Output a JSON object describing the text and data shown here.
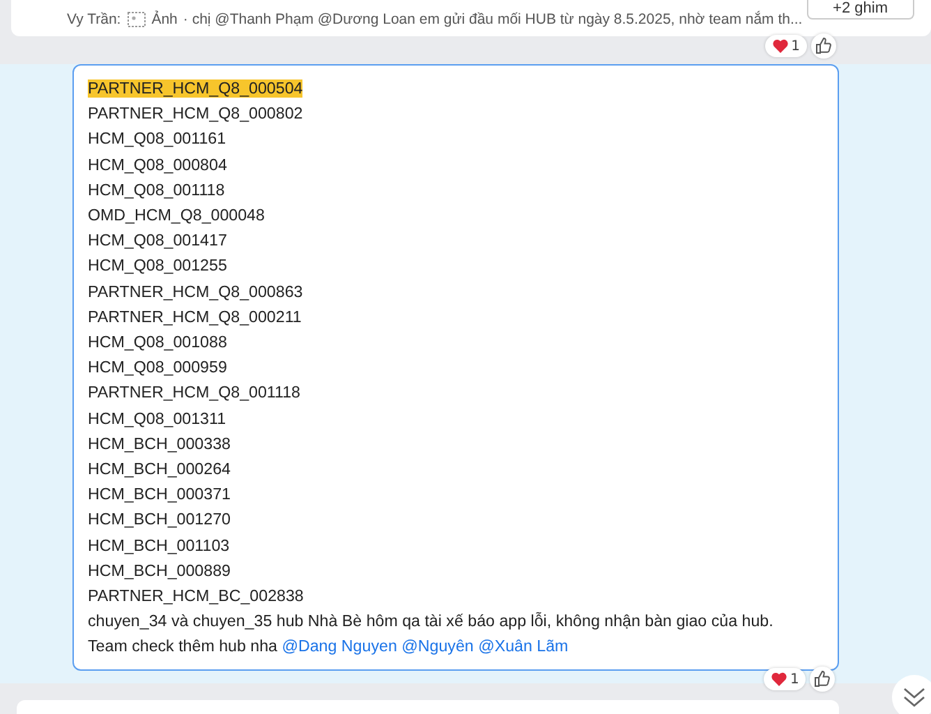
{
  "pinned_bar": {
    "sender": "Vy Trần:",
    "attachment": "Ảnh",
    "preview": "· chị @Thanh Phạm @Dương Loan em gửi đầu mối HUB từ ngày 8.5.2025, nhờ team nắm th...",
    "more_button": "+2 ghim"
  },
  "previous_message": {
    "reactions": {
      "count": "1"
    }
  },
  "message": {
    "selected": true,
    "lines": [
      {
        "text": "PARTNER_HCM_Q8_000504",
        "highlighted": true
      },
      {
        "text": "PARTNER_HCM_Q8_000802",
        "highlighted": false
      },
      {
        "text": "HCM_Q08_001161",
        "highlighted": false
      },
      {
        "text": "HCM_Q08_000804",
        "highlighted": false
      },
      {
        "text": "HCM_Q08_001118",
        "highlighted": false
      },
      {
        "text": "OMD_HCM_Q8_000048",
        "highlighted": false
      },
      {
        "text": "HCM_Q08_001417",
        "highlighted": false
      },
      {
        "text": "HCM_Q08_001255",
        "highlighted": false
      },
      {
        "text": "PARTNER_HCM_Q8_000863",
        "highlighted": false
      },
      {
        "text": "PARTNER_HCM_Q8_000211",
        "highlighted": false
      },
      {
        "text": "HCM_Q08_001088",
        "highlighted": false
      },
      {
        "text": "HCM_Q08_000959",
        "highlighted": false
      },
      {
        "text": "PARTNER_HCM_Q8_001118",
        "highlighted": false
      },
      {
        "text": "HCM_Q08_001311",
        "highlighted": false
      },
      {
        "text": "HCM_BCH_000338",
        "highlighted": false
      },
      {
        "text": "HCM_BCH_000264",
        "highlighted": false
      },
      {
        "text": "HCM_BCH_000371",
        "highlighted": false
      },
      {
        "text": "HCM_BCH_001270",
        "highlighted": false
      },
      {
        "text": "HCM_BCH_001103",
        "highlighted": false
      },
      {
        "text": "HCM_BCH_000889",
        "highlighted": false
      },
      {
        "text": "PARTNER_HCM_BC_002838",
        "highlighted": false
      },
      {
        "text": "chuyen_34 và chuyen_35 hub Nhà Bè hôm qa tài xế báo app lỗi, không nhận bàn giao của hub.",
        "highlighted": false
      }
    ],
    "last_line": {
      "text": "Team check thêm hub nha",
      "mentions": [
        "@Dang Nguyen",
        "@Nguyên",
        "@Xuân Lãm"
      ]
    },
    "reactions": {
      "count": "1"
    }
  }
}
